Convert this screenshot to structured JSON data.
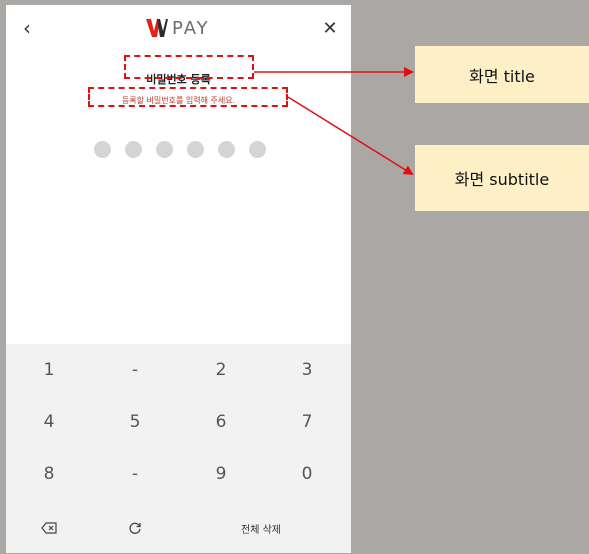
{
  "app": {
    "logo_text": "PAY",
    "back_icon": "chevron-left-icon",
    "close_icon": "close-icon"
  },
  "screen": {
    "title": "비밀번호 등록",
    "subtitle": "등록할 비밀번호를 입력해 주세요."
  },
  "pin": {
    "length": 6,
    "entered": 0
  },
  "keypad": {
    "rows": [
      [
        "1",
        "-",
        "2",
        "3"
      ],
      [
        "4",
        "5",
        "6",
        "7"
      ],
      [
        "8",
        "-",
        "9",
        "0"
      ]
    ],
    "backspace_icon": "backspace-icon",
    "shuffle_icon": "refresh-icon",
    "clear_all_label": "전체 삭제"
  },
  "annotations": {
    "title_note": "화면 title",
    "subtitle_note": "화면 subtitle"
  },
  "colors": {
    "background": "#aaa7a5",
    "logo_red": "#e2231a",
    "logo_dark": "#2d2d2d",
    "highlight": "#e01010",
    "note_bg": "#fdf0c7",
    "keypad_bg": "#f2f2f2",
    "pin_dot": "#d4d4d4"
  }
}
